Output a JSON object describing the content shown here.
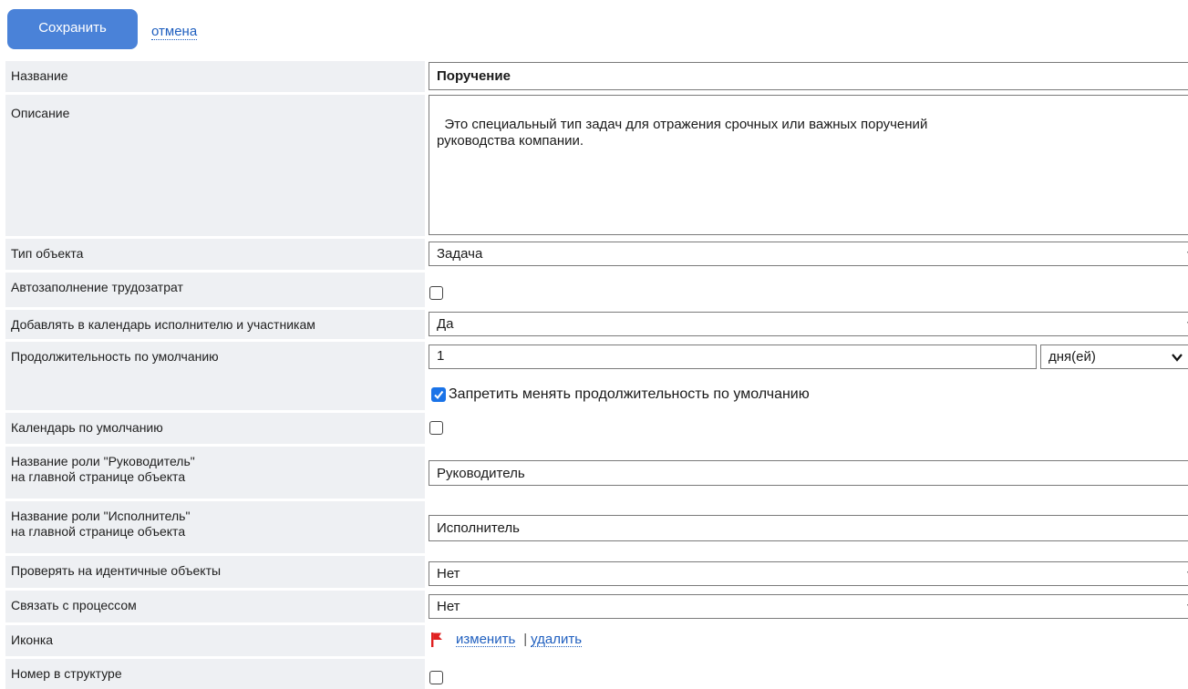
{
  "toolbar": {
    "save_label": "Сохранить",
    "cancel_label": "отмена"
  },
  "form": {
    "name_label": "Название",
    "name_value": "Поручение",
    "description_label": "Описание",
    "description_value": "Это специальный тип задач для отражения срочных или важных поручений\nруководства компании.",
    "object_type_label": "Тип объекта",
    "object_type_value": "Задача",
    "autofill_label": "Автозаполнение трудозатрат",
    "autofill_checked": false,
    "calendar_add_label": "Добавлять в календарь исполнителю и участникам",
    "calendar_add_value": "Да",
    "duration_label": "Продолжительность по умолчанию",
    "duration_value": "1",
    "duration_unit": "дня(ей)",
    "lock_duration_label": "Запретить менять продолжительность по умолчанию",
    "lock_duration_checked": true,
    "default_calendar_label": "Календарь по умолчанию",
    "default_calendar_checked": false,
    "manager_role_label_1": "Название роли \"Руководитель\"",
    "manager_role_label_2": "на главной странице объекта",
    "manager_role_value": "Руководитель",
    "executor_role_label_1": "Название роли \"Исполнитель\"",
    "executor_role_label_2": "на главной странице объекта",
    "executor_role_value": "Исполнитель",
    "check_identical_label": "Проверять на идентичные объекты",
    "check_identical_value": "Нет",
    "link_process_label": "Связать с процессом",
    "link_process_value": "Нет",
    "icon_label": "Иконка",
    "icon_name": "red-flag-icon",
    "icon_color": "#e02020",
    "icon_change_link": "изменить",
    "icon_delete_link": "удалить",
    "structure_number_label": "Номер в структуре",
    "structure_number_checked": false
  },
  "colors": {
    "accent": "#4a82d8",
    "label_bg": "#eef0f3",
    "link": "#1f5fbf",
    "checkbox_checked": "#1a73e8"
  }
}
